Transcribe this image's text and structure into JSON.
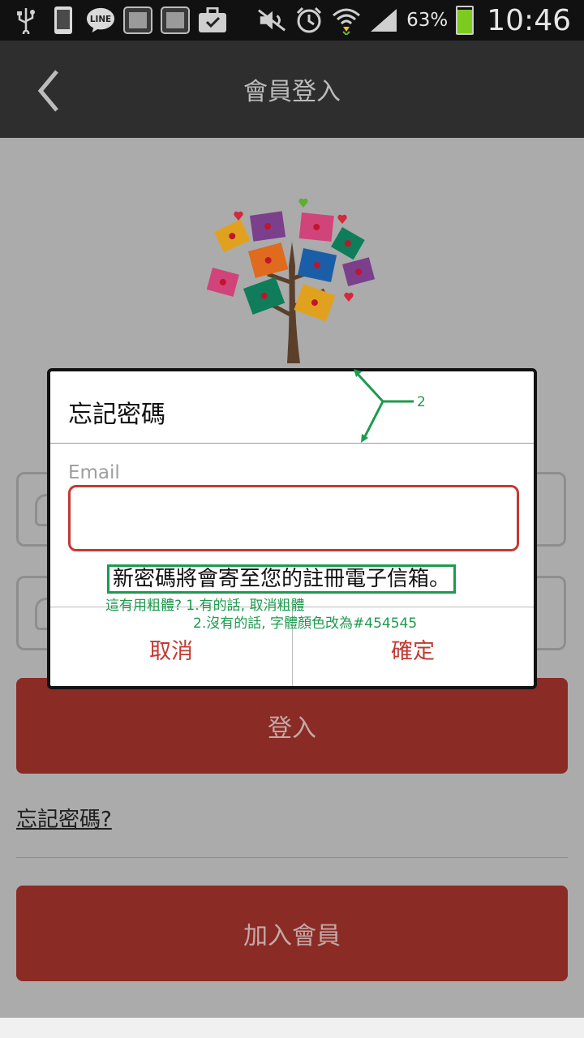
{
  "status_bar": {
    "battery_percent": "63%",
    "time": "10:46",
    "left_icons": [
      "usb-icon",
      "phone-icon",
      "line-icon",
      "gallery-icon",
      "gallery-icon",
      "briefcase-check-icon"
    ],
    "right_icons": [
      "mute-icon",
      "alarm-icon",
      "wifi-icon",
      "signal-icon",
      "battery-charging-icon"
    ]
  },
  "app_bar": {
    "title": "會員登入",
    "back_icon": "chevron-left-icon"
  },
  "login_page": {
    "login_button": "登入",
    "forgot_link": "忘記密碼?",
    "join_button": "加入會員"
  },
  "dialog": {
    "title": "忘記密碼",
    "email_label": "Email",
    "email_value": "",
    "message": "新密碼將會寄至您的註冊電子信箱。",
    "cancel_label": "取消",
    "confirm_label": "確定"
  },
  "annotations": {
    "number": "2",
    "note_line1": "這有用粗體? 1.有的話, 取消粗體",
    "note_line2": "2.沒有的話, 字體顏色改為#454545"
  },
  "colors": {
    "accent_red": "#8a2b26",
    "dialog_red": "#c23a33",
    "annotation_green": "#1d9a4e",
    "app_bar": "#2e2e2e",
    "page_bg": "#ababab"
  }
}
